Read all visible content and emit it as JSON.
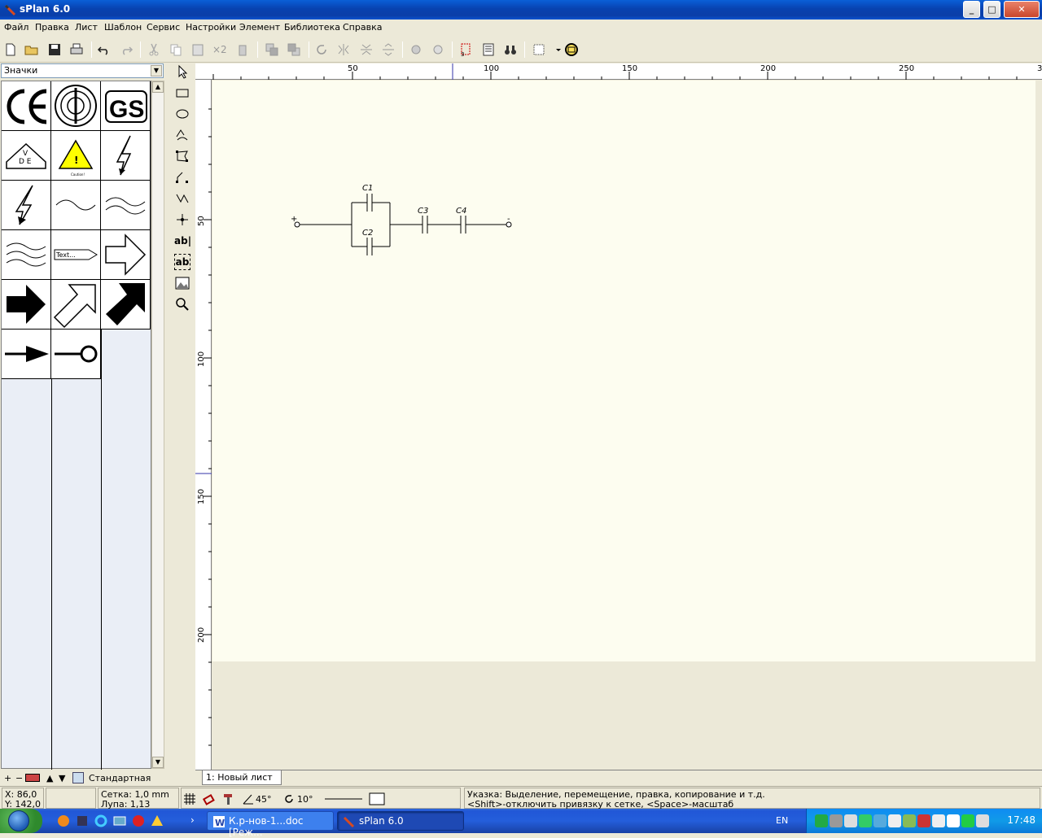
{
  "window": {
    "title": "sPlan 6.0",
    "controls": [
      "_",
      "□",
      "✕"
    ]
  },
  "menu": [
    "Файл",
    "Правка",
    "Лист",
    "Шаблон",
    "Сервис",
    "Настройки",
    "Элемент",
    "Библиотека",
    "Справка"
  ],
  "toolbar": {
    "duplicate_label": "×2"
  },
  "library": {
    "selected": "Значки",
    "bottom_name": "Стандартная",
    "sample_text_label": "Text..."
  },
  "ruler": {
    "h_labels": [
      "50",
      "100",
      "150",
      "200",
      "250",
      "3"
    ],
    "v_labels": [
      "50",
      "100",
      "150",
      "200"
    ]
  },
  "schematic": {
    "labels": [
      "C1",
      "C2",
      "C3",
      "C4"
    ],
    "plus": "+",
    "minus": "-"
  },
  "sheet_tab": "1: Новый лист",
  "status": {
    "x": "X: 86,0",
    "y": "Y: 142,0",
    "grid": "Сетка:  1,0 mm",
    "zoom": "Лупа:   1,13",
    "angle1": "45°",
    "angle2": "10°",
    "hint1": "Указка: Выделение, перемещение, правка, копирование и т.д.",
    "hint2": "<Shift>-отключить привязку к сетке, <Space>-масштаб"
  },
  "taskbar": {
    "tasks": [
      "К.р-нов-1...doc [Реж...",
      "sPlan 6.0"
    ],
    "lang": "EN",
    "time": "17:48"
  },
  "colors": {
    "sheet": "#fdfdf0",
    "title_bar": "#0a3ea8",
    "warning_yellow": "#ffff00"
  }
}
